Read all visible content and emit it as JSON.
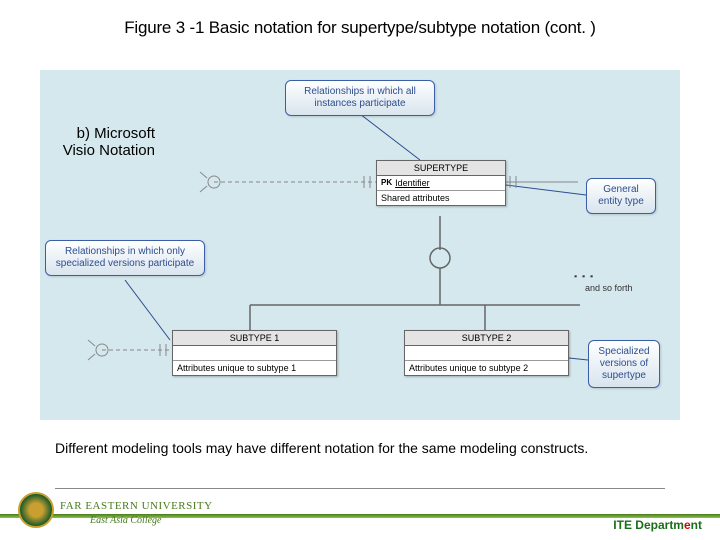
{
  "title": "Figure 3 -1 Basic notation for supertype/subtype notation (cont. )",
  "subtitle": "b) Microsoft Visio Notation",
  "callouts": {
    "c1": "Relationships in which all instances participate",
    "c2": "Relationships in which only specialized versions participate",
    "c3": "General entity type",
    "c4": "Specialized versions of supertype"
  },
  "entities": {
    "supertype": {
      "name": "SUPERTYPE",
      "pk": "PK",
      "pkfield": "Identifier",
      "attr": "Shared attributes"
    },
    "sub1": {
      "name": "SUBTYPE 1",
      "attr": "Attributes unique to subtype 1"
    },
    "sub2": {
      "name": "SUBTYPE 2",
      "attr": "Attributes unique to subtype 2"
    }
  },
  "andso": "and so forth",
  "footnote": "Different modeling tools may have different notation for the same modeling constructs.",
  "footer": {
    "univ": "FAR EASTERN UNIVERSITY",
    "col": "East Asia College",
    "dept": "ITE Departm",
    "deptR": "e",
    "dept2": "nt"
  }
}
